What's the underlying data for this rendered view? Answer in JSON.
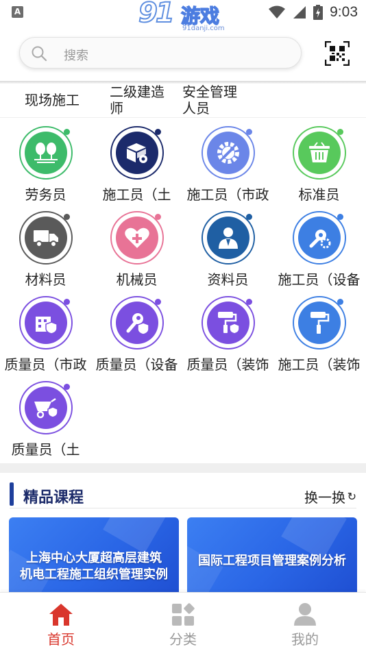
{
  "status_bar": {
    "time": "9:03",
    "notification_icon": "a-icon",
    "logo_number": "91",
    "logo_text": "游戏",
    "logo_url": "91danji.com"
  },
  "search": {
    "placeholder": "搜索",
    "scan_icon": "qr-code-icon"
  },
  "categories": [
    "现场施工",
    "二级建造\n师",
    "安全管理\n人员"
  ],
  "roles": [
    {
      "label": "劳务员",
      "color": "#3dbb6a",
      "icon": "trees-icon"
    },
    {
      "label": "施工员（土",
      "color": "#1b2a6b",
      "icon": "box-gear-icon"
    },
    {
      "label": "施工员（市政",
      "color": "#6b86e8",
      "icon": "wrench-gear-icon"
    },
    {
      "label": "标准员",
      "color": "#58c95c",
      "icon": "basket-icon"
    },
    {
      "label": "材料员",
      "color": "#5a5a5a",
      "icon": "truck-icon"
    },
    {
      "label": "机械员",
      "color": "#e87396",
      "icon": "heart-plus-icon"
    },
    {
      "label": "资料员",
      "color": "#1f5fa3",
      "icon": "person-icon"
    },
    {
      "label": "施工员（设备",
      "color": "#3d7fe3",
      "icon": "wrench-gear-icon"
    },
    {
      "label": "质量员（市政",
      "color": "#7b4fe0",
      "icon": "building-shield-icon"
    },
    {
      "label": "质量员（设备",
      "color": "#7b4fe0",
      "icon": "wrench-shield-icon"
    },
    {
      "label": "质量员（装饰",
      "color": "#7b4fe0",
      "icon": "paint-roller-shield-icon"
    },
    {
      "label": "施工员（装饰",
      "color": "#3d7fe3",
      "icon": "paint-roller-icon"
    },
    {
      "label": "质量员（土",
      "color": "#7b4fe0",
      "icon": "wheelbarrow-shield-icon"
    }
  ],
  "courses": {
    "title": "精品课程",
    "refresh_label": "换一换",
    "refresh_icon": "↻",
    "cards": [
      {
        "line1": "上海中心大厦超高层建筑",
        "line2": "机电工程施工组织管理实例"
      },
      {
        "line1": "国际工程项目管理案例分析",
        "line2": ""
      }
    ]
  },
  "bottom_nav": [
    {
      "label": "首页",
      "icon": "home-icon",
      "color": "#d9362c",
      "active": true
    },
    {
      "label": "分类",
      "icon": "category-icon",
      "color": "#b9b9b9",
      "active": false
    },
    {
      "label": "我的",
      "icon": "user-icon",
      "color": "#b9b9b9",
      "active": false
    }
  ]
}
